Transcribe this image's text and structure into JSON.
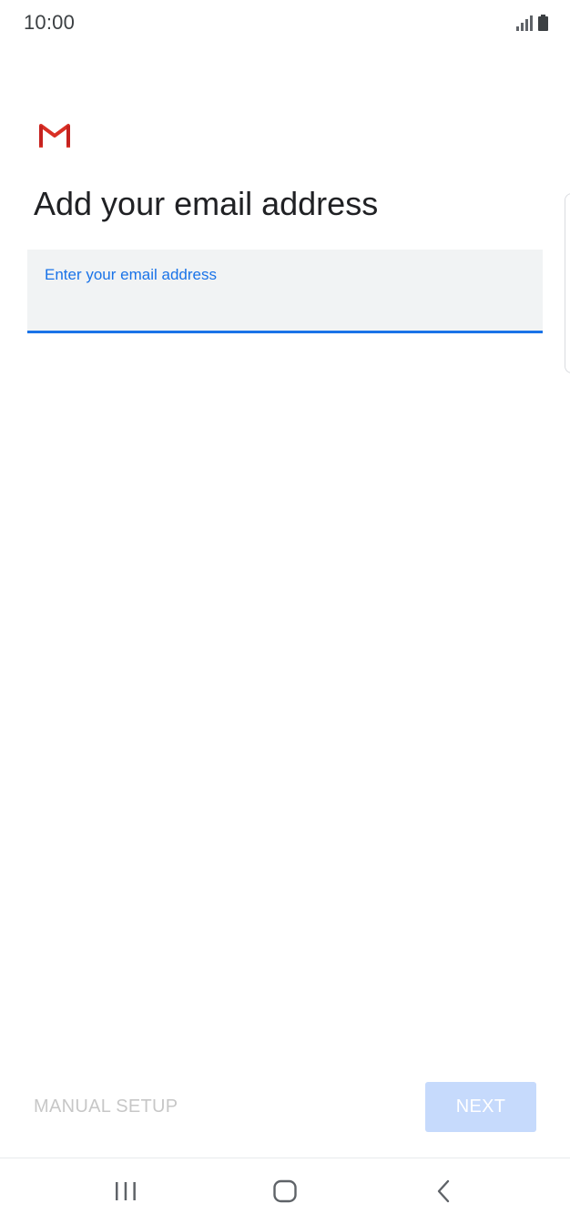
{
  "status_bar": {
    "time": "10:00",
    "icons": [
      "signal-icon",
      "battery-icon"
    ]
  },
  "logo": {
    "name": "gmail-logo",
    "color": "#d93025"
  },
  "page": {
    "title": "Add your email address"
  },
  "email_field": {
    "label": "Enter your email address",
    "value": "",
    "accent_color": "#1a73e8"
  },
  "actions": {
    "manual_setup_label": "MANUAL SETUP",
    "next_label": "NEXT"
  },
  "nav_bar": {
    "buttons": [
      "recent-apps-icon",
      "home-icon",
      "back-icon"
    ]
  }
}
